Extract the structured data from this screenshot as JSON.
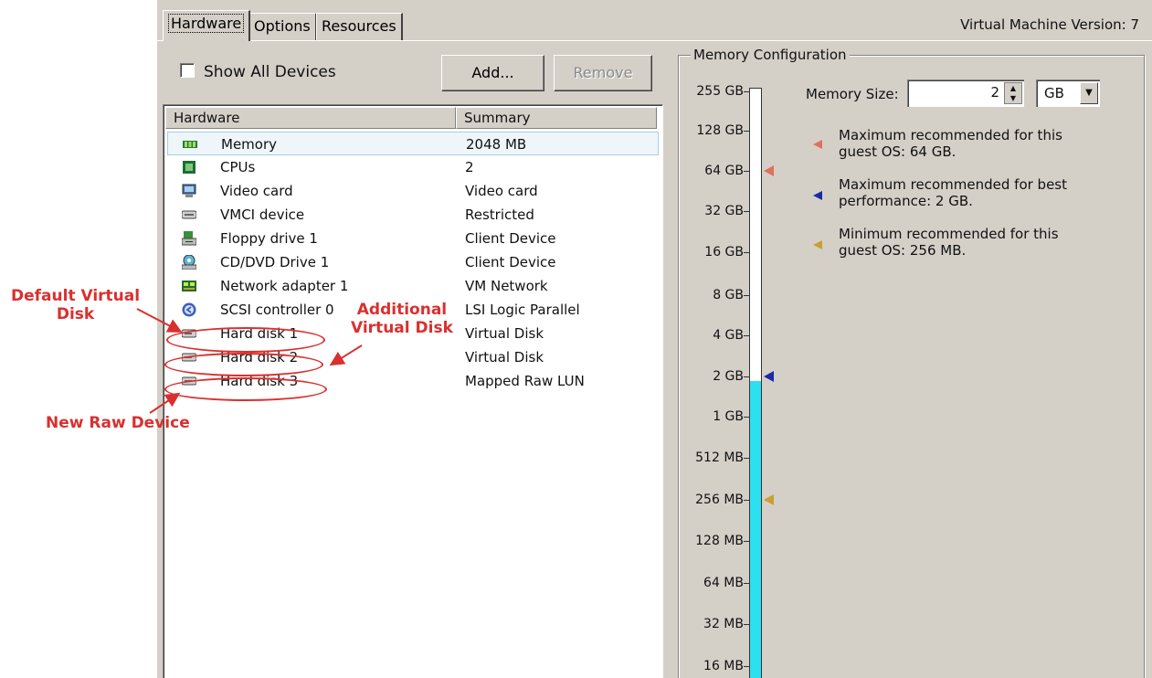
{
  "tabs": [
    {
      "label": "Hardware",
      "active": true
    },
    {
      "label": "Options",
      "active": false
    },
    {
      "label": "Resources",
      "active": false
    }
  ],
  "vm_version": "Virtual Machine Version: 7",
  "show_all_devices": {
    "label": "Show All Devices",
    "checked": false
  },
  "buttons": {
    "add": "Add...",
    "remove": "Remove"
  },
  "hardware_list": {
    "columns": [
      "Hardware",
      "Summary"
    ],
    "rows": [
      {
        "name": "Memory",
        "summary": "2048 MB",
        "icon": "memory-icon",
        "selected": true
      },
      {
        "name": "CPUs",
        "summary": "2",
        "icon": "cpu-icon"
      },
      {
        "name": "Video card",
        "summary": "Video card",
        "icon": "monitor-icon"
      },
      {
        "name": "VMCI device",
        "summary": "Restricted",
        "icon": "device-icon"
      },
      {
        "name": "Floppy drive 1",
        "summary": "Client Device",
        "icon": "floppy-icon"
      },
      {
        "name": "CD/DVD Drive 1",
        "summary": "Client Device",
        "icon": "cd-icon"
      },
      {
        "name": "Network adapter 1",
        "summary": "VM Network",
        "icon": "network-icon"
      },
      {
        "name": "SCSI controller 0",
        "summary": "LSI Logic Parallel",
        "icon": "scsi-icon"
      },
      {
        "name": "Hard disk 1",
        "summary": "Virtual Disk",
        "icon": "disk-icon"
      },
      {
        "name": "Hard disk 2",
        "summary": "Virtual Disk",
        "icon": "disk-icon"
      },
      {
        "name": "Hard disk 3",
        "summary": "Mapped Raw LUN",
        "icon": "disk-icon"
      }
    ]
  },
  "memory_config": {
    "title": "Memory Configuration",
    "scale_labels": [
      "255 GB",
      "128 GB",
      "64 GB",
      "32 GB",
      "16 GB",
      "8 GB",
      "4 GB",
      "2 GB",
      "1 GB",
      "512 MB",
      "256 MB",
      "128 MB",
      "64 MB",
      "32 MB",
      "16 MB"
    ],
    "memory_size_label": "Memory Size:",
    "memory_size_value": "2",
    "unit": "GB",
    "recommendations": [
      {
        "line1": "Maximum recommended for this",
        "line2": "guest OS: 64 GB.",
        "color": "#e07060"
      },
      {
        "line1": "Maximum recommended for best",
        "line2": "performance: 2 GB.",
        "color": "#1a2aa8"
      },
      {
        "line1": "Minimum recommended for this",
        "line2": "guest OS: 256 MB.",
        "color": "#c8a030"
      }
    ],
    "current_value_level": "2 GB"
  },
  "annotations": {
    "default_virtual_disk": [
      "Default Virtual",
      "Disk"
    ],
    "additional_virtual_disk": [
      "Additional",
      "Virtual Disk"
    ],
    "new_raw_device": "New Raw Device",
    "color": "#d9302f"
  }
}
